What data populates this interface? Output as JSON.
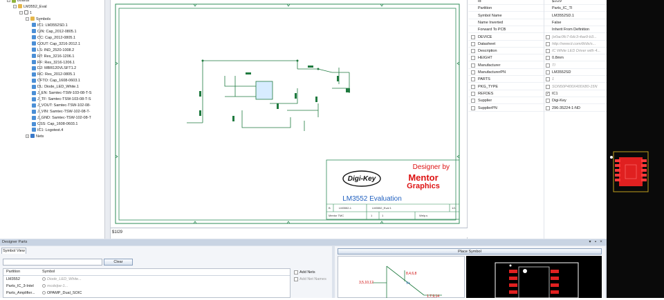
{
  "tree": {
    "items": [
      {
        "label": "Boards",
        "indent": 0,
        "kind": "root"
      },
      {
        "label": "LM3552_Eval",
        "indent": 1,
        "kind": "folder"
      },
      {
        "label": "1",
        "indent": 2,
        "kind": "page"
      },
      {
        "label": "Symbols",
        "indent": 3,
        "kind": "folder"
      },
      {
        "label": "IC1: LM3552SD.1",
        "indent": 4,
        "kind": "sym"
      },
      {
        "label": "CIN: Cap_2012-0805.1",
        "indent": 4,
        "kind": "sym"
      },
      {
        "label": "CC: Cap_2012-0805.1",
        "indent": 4,
        "kind": "sym"
      },
      {
        "label": "COUT: Cap_3216-2012.1",
        "indent": 4,
        "kind": "sym"
      },
      {
        "label": "LS: IND_2520-1008.2",
        "indent": 4,
        "kind": "sym"
      },
      {
        "label": "RT: Res_3216-1206.1",
        "indent": 4,
        "kind": "sym"
      },
      {
        "label": "RF: Res_3216-1206.1",
        "indent": 4,
        "kind": "sym"
      },
      {
        "label": "D2: MBR120VLSFT1.2",
        "indent": 4,
        "kind": "sym"
      },
      {
        "label": "RC: Res_2012-0805.1",
        "indent": 4,
        "kind": "sym"
      },
      {
        "label": "CFTO: Cap_1608-0603.1",
        "indent": 4,
        "kind": "sym"
      },
      {
        "label": "DL: Diode_LED_White.1",
        "indent": 4,
        "kind": "sym"
      },
      {
        "label": "J_EN: Samtec-TSW-103-08-T-S",
        "indent": 4,
        "kind": "sym"
      },
      {
        "label": "J_TF: Samtec-TSW-103-08-T-S",
        "indent": 4,
        "kind": "sym"
      },
      {
        "label": "J_VOUT: Samtec-TSW-102-08-",
        "indent": 4,
        "kind": "sym"
      },
      {
        "label": "J_VIN: Samtec-TSW-102-08-T-",
        "indent": 4,
        "kind": "sym"
      },
      {
        "label": "J_GND: Samtec-TSW-102-08-T",
        "indent": 4,
        "kind": "sym"
      },
      {
        "label": "CSS: Cap_1608-0603.1",
        "indent": 4,
        "kind": "sym"
      },
      {
        "label": "IC1: Logotest.4",
        "indent": 4,
        "kind": "sym"
      },
      {
        "label": "Nets",
        "indent": 3,
        "kind": "net"
      }
    ]
  },
  "canvas": {
    "status_text": "$1I29",
    "title_block": {
      "designer_by": "Designer by",
      "brand_left": "Digi-Key",
      "brand_right_1": "Mentor",
      "brand_right_2": "Graphics",
      "project_title": "LM3552 Evaluation",
      "row1": [
        "B",
        "LM3552-1",
        "LM3552_Eval 1",
        "1/1"
      ],
      "row2": [
        "Mentor TMC",
        "1",
        "1",
        "Welp.s"
      ]
    }
  },
  "properties": {
    "rows": [
      {
        "name": "Id",
        "value": "$1I29",
        "check": false,
        "cb": false,
        "cb2": false,
        "gray": false
      },
      {
        "name": "Partition",
        "value": "Parts_IC_TI",
        "check": false,
        "cb": false,
        "cb2": false,
        "gray": false
      },
      {
        "name": "Symbol Name",
        "value": "LM3552SD.1",
        "check": false,
        "cb": false,
        "cb2": false,
        "gray": false
      },
      {
        "name": "Name Inverted",
        "value": "False",
        "check": false,
        "cb": false,
        "cb2": false,
        "gray": false
      },
      {
        "name": "Forward To PCB",
        "value": "Inherit From Definition",
        "check": false,
        "cb": false,
        "cb2": false,
        "gray": false
      },
      {
        "name": "DEVICE",
        "value": "{e0ac0fc7-6dc3-4ae9-b3...",
        "check": false,
        "cb": true,
        "cb2": true,
        "gray": true
      },
      {
        "name": "Datasheet",
        "value": "http://www.ti.com/lit/ds/s...",
        "check": false,
        "cb": true,
        "cb2": true,
        "gray": true
      },
      {
        "name": "Description",
        "value": "IC White LED Driver with 4...",
        "check": false,
        "cb": true,
        "cb2": true,
        "gray": true
      },
      {
        "name": "HEIGHT",
        "value": "0.8mm",
        "check": false,
        "cb": true,
        "cb2": true,
        "gray": false
      },
      {
        "name": "Manufacturer",
        "value": "TI",
        "check": false,
        "cb": true,
        "cb2": true,
        "gray": true
      },
      {
        "name": "ManufacturerPN",
        "value": "LM3552SD",
        "check": false,
        "cb": true,
        "cb2": true,
        "gray": false
      },
      {
        "name": "PARTS",
        "value": "1",
        "check": false,
        "cb": true,
        "cb2": true,
        "gray": true
      },
      {
        "name": "PKG_TYPE",
        "value": "SON50P400X400X80-15N",
        "check": false,
        "cb": true,
        "cb2": true,
        "gray": true
      },
      {
        "name": "REFDES",
        "value": "IC1",
        "check": true,
        "cb": true,
        "cb2": true,
        "gray": false
      },
      {
        "name": "Supplier",
        "value": "Digi-Key",
        "check": false,
        "cb": true,
        "cb2": true,
        "gray": false
      },
      {
        "name": "SupplierPN",
        "value": "296-35224-1-ND",
        "check": false,
        "cb": true,
        "cb2": true,
        "gray": false
      }
    ]
  },
  "designer_parts": {
    "title": "Designer Parts",
    "tab": "Symbol View",
    "clear_label": "Clear",
    "search_value": "",
    "columns": [
      "Partition",
      "Symbol"
    ],
    "rows": [
      {
        "partition": "LM3552",
        "symbol": "Diode_LED_White...",
        "gray": true
      },
      {
        "partition": "Parts_IC_3-Intel",
        "symbol": "mcdelpe-1...",
        "gray": true
      },
      {
        "partition": "Parts_Amplifier...",
        "symbol": "OPAMP_Dual_SOIC",
        "gray": false
      }
    ],
    "add_nets": "Add Nets",
    "add_net_names": "Add Net Names",
    "place_symbol": "Place Symbol",
    "preview_labels": {
      "pins_a": "3,5,10,12",
      "pins_b": "8,4,6,8",
      "vplus": "V+",
      "pins_c": "1,7,9,14"
    }
  }
}
